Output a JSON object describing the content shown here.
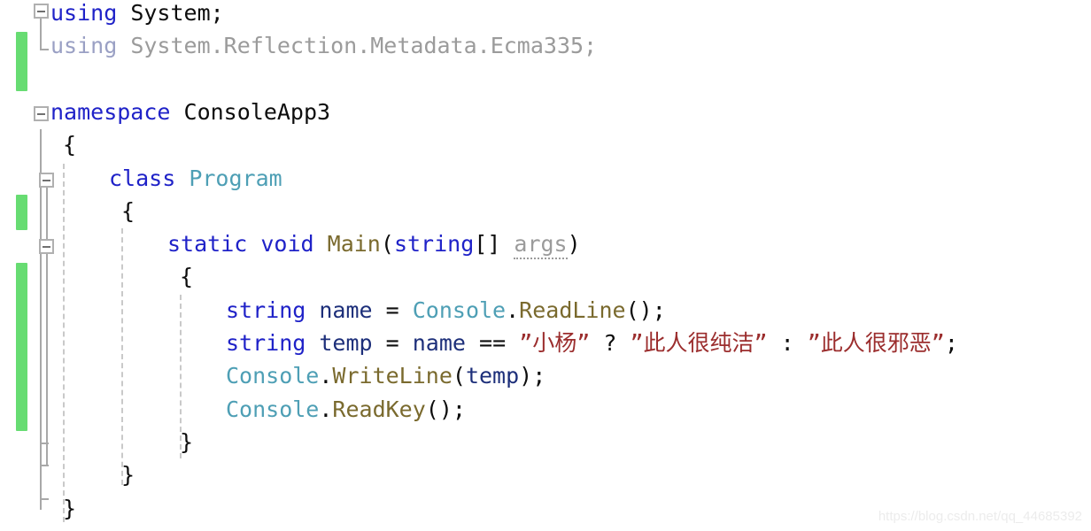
{
  "editor": {
    "language": "csharp",
    "background_color": "#ffffff",
    "colors": {
      "keyword": "#1f22c8",
      "type": "#4e9fb5",
      "method": "#7a6a2e",
      "local_variable": "#1d2f7a",
      "string": "#9b2d2d",
      "plain_text": "#0d0d0d",
      "unused_using": "#9aa0c4",
      "unused_parameter": "#9b9b9b",
      "change_bar_green": "#67dc72",
      "outline_line": "#a8a8a8",
      "indent_guide": "#c9c9c9",
      "collapse_box_border": "#b0b0b0"
    }
  },
  "gutter": {
    "collapse_boxes": [
      {
        "name": "collapse-using-block",
        "state": "expanded",
        "glyph": "-"
      },
      {
        "name": "collapse-namespace-block",
        "state": "expanded",
        "glyph": "-"
      },
      {
        "name": "collapse-class-block",
        "state": "expanded",
        "glyph": "-"
      },
      {
        "name": "collapse-main-method-block",
        "state": "expanded",
        "glyph": "-"
      }
    ],
    "change_bars": [
      {
        "name": "change-bar-using-region"
      },
      {
        "name": "change-bar-class-region"
      },
      {
        "name": "change-bar-main-region"
      }
    ]
  },
  "code": {
    "lines": [
      {
        "id": "line-using-system",
        "indent": 0,
        "tokens": [
          {
            "text": "using",
            "style": "keyword"
          },
          {
            "text": " System;",
            "style": "plain"
          }
        ]
      },
      {
        "id": "line-using-reflection",
        "indent": 0,
        "tokens": [
          {
            "text": "using",
            "style": "unused-using"
          },
          {
            "text": " System.Reflection.Metadata.Ecma335;",
            "style": "unused"
          }
        ]
      },
      {
        "id": "line-blank-1",
        "indent": 0,
        "tokens": []
      },
      {
        "id": "line-namespace",
        "indent": 0,
        "tokens": [
          {
            "text": "namespace",
            "style": "keyword"
          },
          {
            "text": " ConsoleApp3",
            "style": "plain"
          }
        ]
      },
      {
        "id": "line-namespace-open-brace",
        "indent": 0,
        "tokens": [
          {
            "text": "{",
            "style": "plain"
          }
        ]
      },
      {
        "id": "line-class-program",
        "indent": 1,
        "tokens": [
          {
            "text": "class",
            "style": "keyword"
          },
          {
            "text": " ",
            "style": "plain"
          },
          {
            "text": "Program",
            "style": "type"
          }
        ]
      },
      {
        "id": "line-class-open-brace",
        "indent": 1,
        "tokens": [
          {
            "text": "{",
            "style": "plain"
          }
        ]
      },
      {
        "id": "line-main-signature",
        "indent": 2,
        "tokens": [
          {
            "text": "static",
            "style": "keyword"
          },
          {
            "text": " ",
            "style": "plain"
          },
          {
            "text": "void",
            "style": "keyword"
          },
          {
            "text": " ",
            "style": "plain"
          },
          {
            "text": "Main",
            "style": "method"
          },
          {
            "text": "(",
            "style": "plain"
          },
          {
            "text": "string",
            "style": "keyword"
          },
          {
            "text": "[] ",
            "style": "plain"
          },
          {
            "text": "args",
            "style": "unused-underline"
          },
          {
            "text": ")",
            "style": "plain"
          }
        ]
      },
      {
        "id": "line-main-open-brace",
        "indent": 2,
        "tokens": [
          {
            "text": "{",
            "style": "plain"
          }
        ]
      },
      {
        "id": "line-read-name",
        "indent": 3,
        "tokens": [
          {
            "text": "string",
            "style": "keyword"
          },
          {
            "text": " ",
            "style": "plain"
          },
          {
            "text": "name",
            "style": "local"
          },
          {
            "text": " = ",
            "style": "plain"
          },
          {
            "text": "Console",
            "style": "type"
          },
          {
            "text": ".",
            "style": "plain"
          },
          {
            "text": "ReadLine",
            "style": "method"
          },
          {
            "text": "();",
            "style": "plain"
          }
        ]
      },
      {
        "id": "line-ternary-temp",
        "indent": 3,
        "tokens": [
          {
            "text": "string",
            "style": "keyword"
          },
          {
            "text": " ",
            "style": "plain"
          },
          {
            "text": "temp",
            "style": "local"
          },
          {
            "text": " = ",
            "style": "plain"
          },
          {
            "text": "name",
            "style": "local"
          },
          {
            "text": " == ",
            "style": "plain"
          },
          {
            "text": "”小杨”",
            "style": "string"
          },
          {
            "text": " ? ",
            "style": "plain"
          },
          {
            "text": "”此人很纯洁”",
            "style": "string"
          },
          {
            "text": " : ",
            "style": "plain"
          },
          {
            "text": "”此人很邪恶”",
            "style": "string"
          },
          {
            "text": ";",
            "style": "plain"
          }
        ]
      },
      {
        "id": "line-writeline-temp",
        "indent": 3,
        "tokens": [
          {
            "text": "Console",
            "style": "type"
          },
          {
            "text": ".",
            "style": "plain"
          },
          {
            "text": "WriteLine",
            "style": "method"
          },
          {
            "text": "(",
            "style": "plain"
          },
          {
            "text": "temp",
            "style": "local"
          },
          {
            "text": ");",
            "style": "plain"
          }
        ]
      },
      {
        "id": "line-readkey",
        "indent": 3,
        "tokens": [
          {
            "text": "Console",
            "style": "type"
          },
          {
            "text": ".",
            "style": "plain"
          },
          {
            "text": "ReadKey",
            "style": "method"
          },
          {
            "text": "();",
            "style": "plain"
          }
        ]
      },
      {
        "id": "line-main-close-brace",
        "indent": 2,
        "tokens": [
          {
            "text": "}",
            "style": "plain"
          }
        ]
      },
      {
        "id": "line-class-close-brace",
        "indent": 1,
        "tokens": [
          {
            "text": "}",
            "style": "plain"
          }
        ]
      },
      {
        "id": "line-namespace-close-brace",
        "indent": 0,
        "tokens": [
          {
            "text": "}",
            "style": "plain"
          }
        ]
      }
    ]
  },
  "watermark": {
    "text": "https://blog.csdn.net/qq_44685392"
  }
}
